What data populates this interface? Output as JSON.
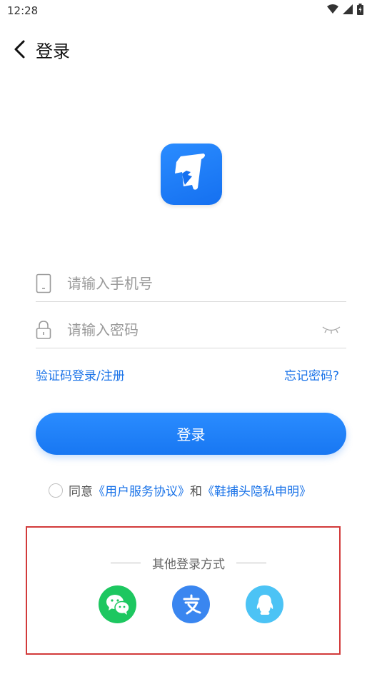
{
  "status_bar": {
    "time": "12:28"
  },
  "header": {
    "title": "登录"
  },
  "form": {
    "phone_placeholder": "请输入手机号",
    "password_placeholder": "请输入密码"
  },
  "links": {
    "sms_login": "验证码登录/注册",
    "forgot_password": "忘记密码?"
  },
  "login_button": "登录",
  "agreement": {
    "prefix": "同意",
    "user_agreement": "《用户服务协议》",
    "conjunction": "和",
    "privacy": "《鞋捕头隐私申明》"
  },
  "other_login": {
    "title": "其他登录方式",
    "methods": [
      "wechat-icon",
      "alipay-icon",
      "qq-icon"
    ]
  },
  "colors": {
    "accent": "#1877F2",
    "wechat": "#1DC760",
    "alipay": "#3A86F0",
    "qq": "#4CC3F5",
    "highlight_box": "#D23A3A"
  }
}
